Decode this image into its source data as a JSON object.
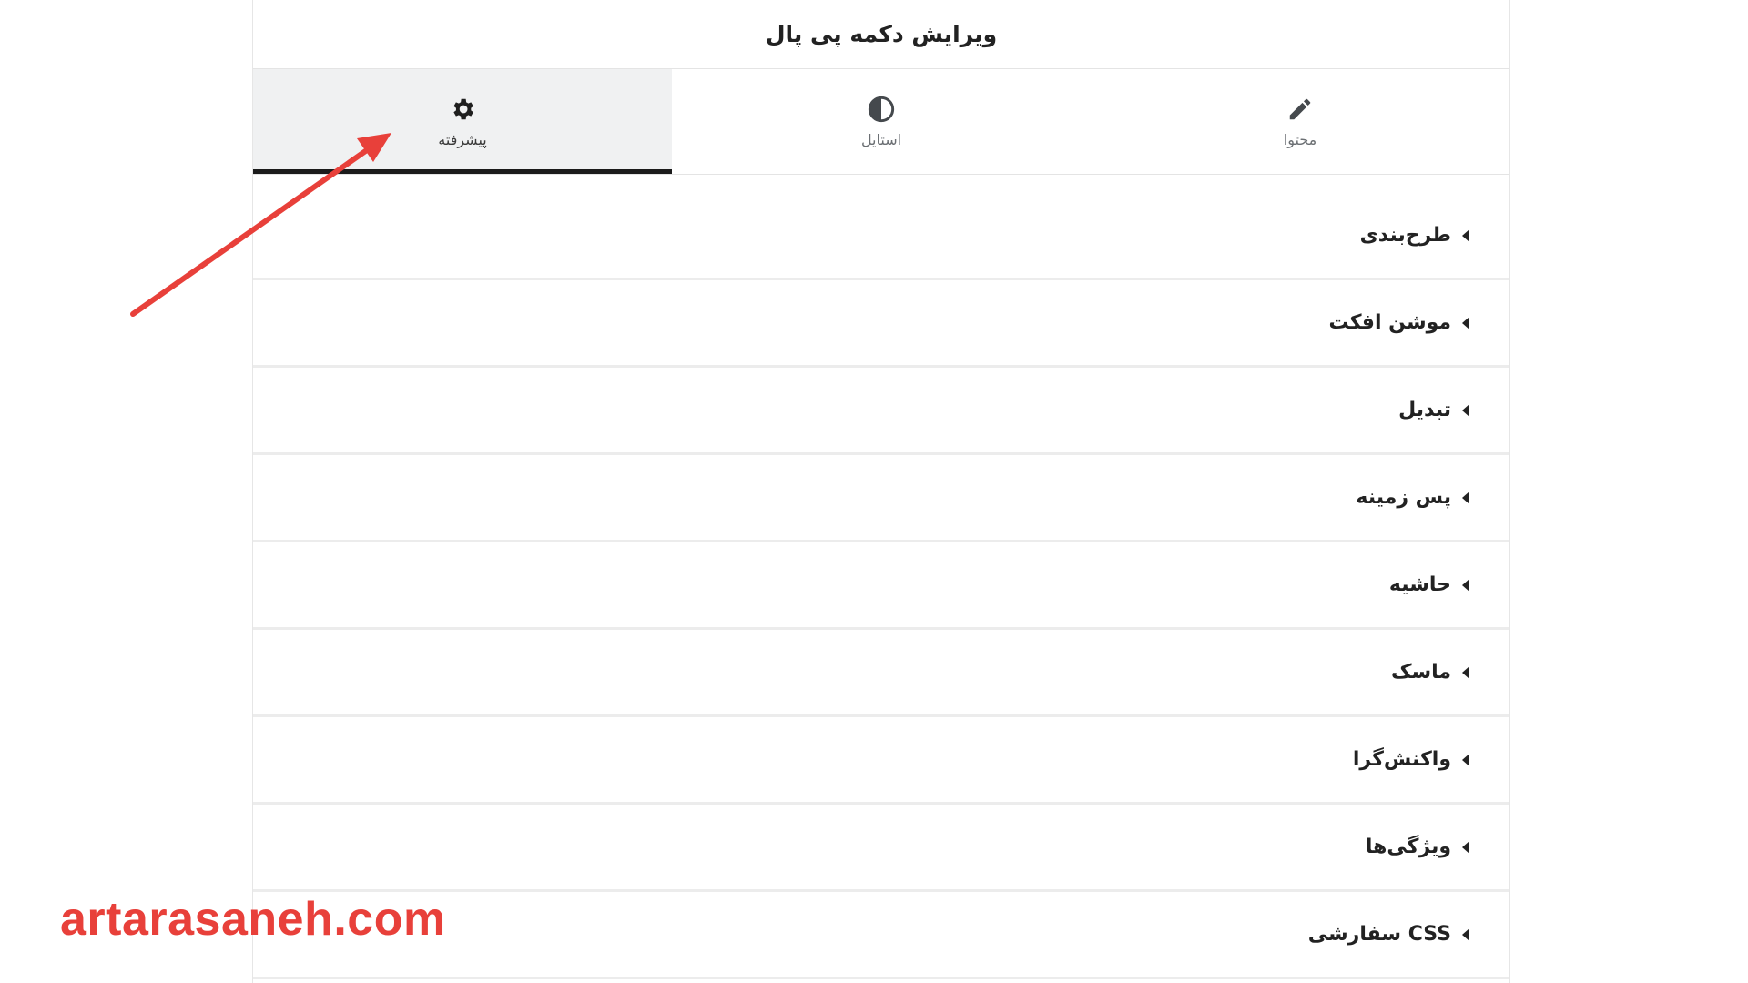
{
  "panel": {
    "title": "ویرایش دکمه پی پال"
  },
  "tabs": [
    {
      "label": "پیشرفته",
      "icon": "gear-icon",
      "active": true
    },
    {
      "label": "استایل",
      "icon": "contrast-icon",
      "active": false
    },
    {
      "label": "محتوا",
      "icon": "pencil-icon",
      "active": false
    }
  ],
  "sections": [
    {
      "label": "طرح‌بندی"
    },
    {
      "label": "موشن افکت"
    },
    {
      "label": "تبدیل"
    },
    {
      "label": "پس زمینه"
    },
    {
      "label": "حاشیه"
    },
    {
      "label": "ماسک"
    },
    {
      "label": "واکنش‌گرا"
    },
    {
      "label": "ویژگی‌ها"
    },
    {
      "label": "CSS سفارشی"
    }
  ],
  "annotation": {
    "arrow_color": "#e8403a"
  },
  "watermark": {
    "text": "artarasaneh.com",
    "color": "#e8403a"
  }
}
